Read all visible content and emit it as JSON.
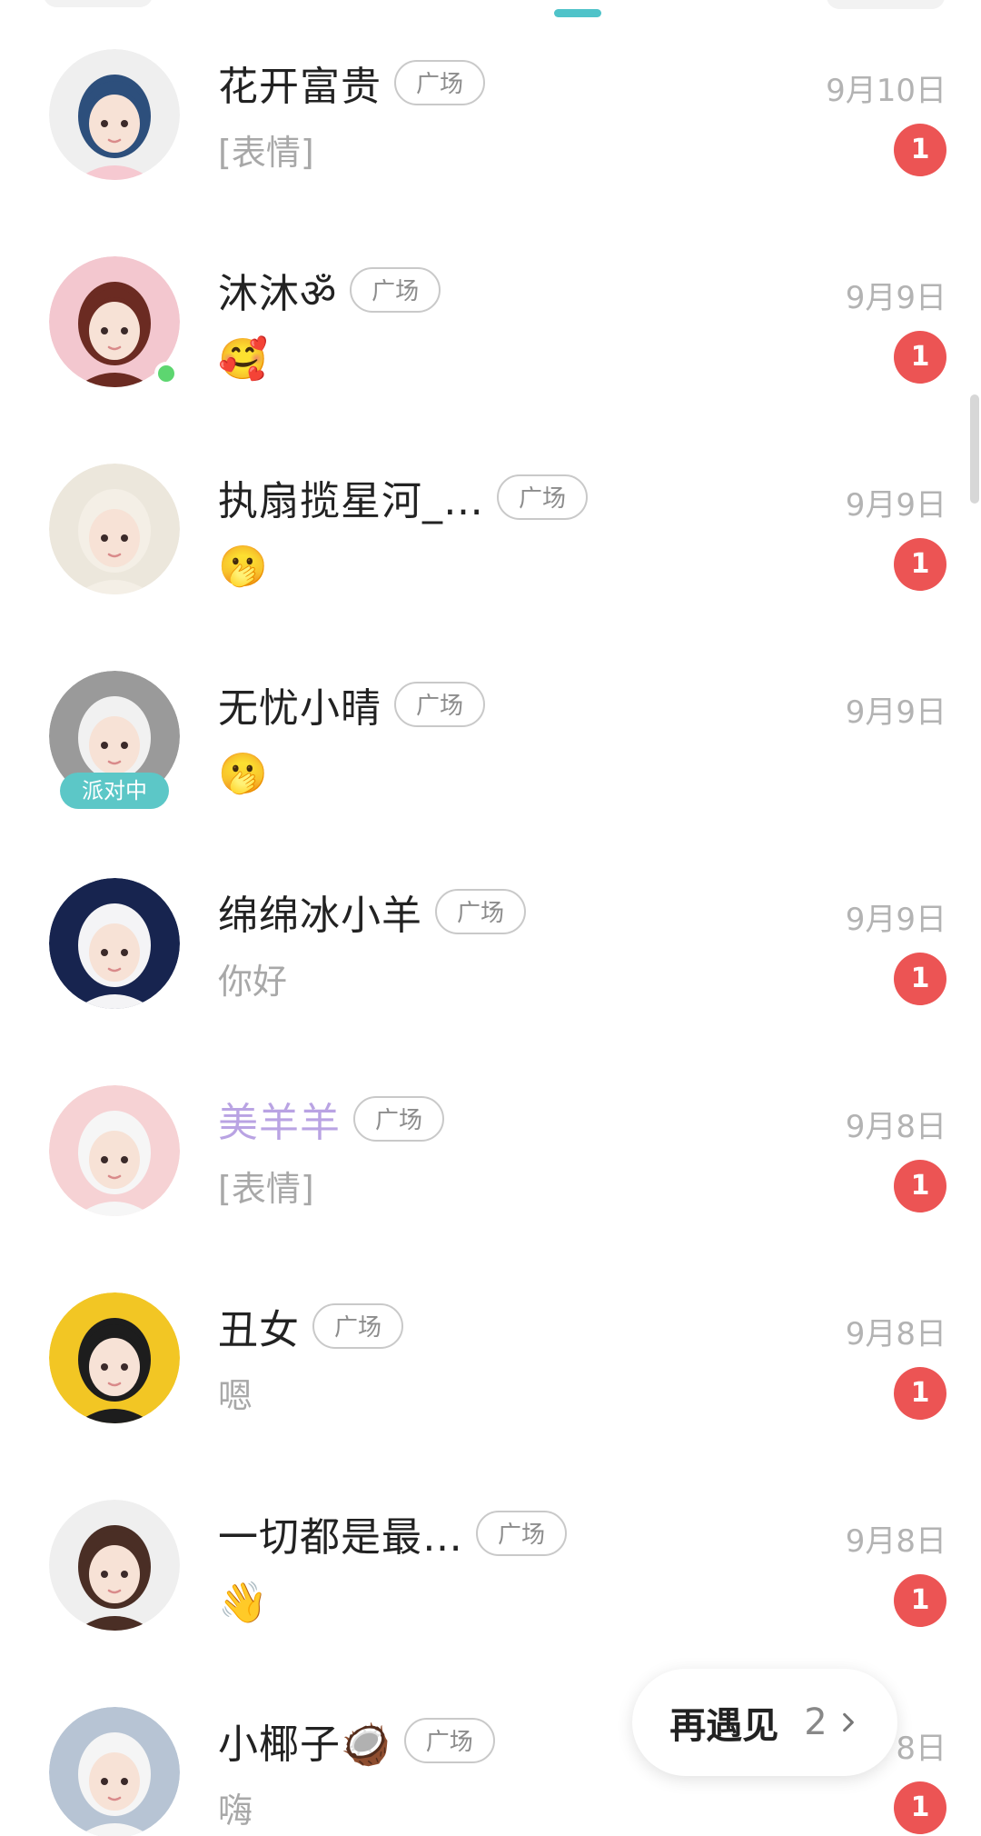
{
  "header": {
    "active_tab_color": "#4fc3c9"
  },
  "conversations": [
    {
      "name": "花开富贵",
      "tag": "广场",
      "time": "9月10日",
      "preview": "[表情]",
      "unread": "1",
      "avatar_bg": "#efefef",
      "avatar_icon": "girl-mask-avatar-icon"
    },
    {
      "name": "沐沐ॐ",
      "tag": "广场",
      "time": "9月9日",
      "preview": "🥰",
      "unread": "1",
      "avatar_bg": "#f3c7cf",
      "avatar_icon": "girl-cat-ears-avatar-icon",
      "online": true
    },
    {
      "name": "执扇揽星河_…",
      "tag": "广场",
      "time": "9月9日",
      "preview": "🫢",
      "unread": "1",
      "avatar_bg": "#ece7dc",
      "avatar_icon": "white-hair-girl-avatar-icon"
    },
    {
      "name": "无忧小晴",
      "tag": "广场",
      "time": "9月9日",
      "preview": "🫢",
      "unread": "",
      "avatar_bg": "#9a9a9a",
      "avatar_icon": "silver-hair-avatar-icon",
      "badge": "派对中"
    },
    {
      "name": "绵绵冰小羊",
      "tag": "广场",
      "time": "9月9日",
      "preview": "你好",
      "unread": "1",
      "avatar_bg": "#17244f",
      "avatar_icon": "sheep-girl-avatar-icon"
    },
    {
      "name": "美羊羊",
      "tag": "广场",
      "time": "9月8日",
      "preview": "[表情]",
      "unread": "1",
      "avatar_bg": "#f6d2d4",
      "avatar_icon": "pink-bow-girl-avatar-icon",
      "vip": true
    },
    {
      "name": "丑女",
      "tag": "广场",
      "time": "9月8日",
      "preview": "嗯",
      "unread": "1",
      "avatar_bg": "#f2c624",
      "avatar_icon": "black-hair-girl-avatar-icon"
    },
    {
      "name": "一切都是最…",
      "tag": "广场",
      "time": "9月8日",
      "preview": "👋",
      "unread": "1",
      "avatar_bg": "#efefef",
      "avatar_icon": "brown-hair-girl-avatar-icon"
    },
    {
      "name": "小椰子🥥",
      "tag": "广场",
      "time": "8日",
      "preview": "嗨",
      "unread": "1",
      "avatar_bg": "#b7c4d4",
      "avatar_icon": "white-hair-angry-avatar-icon"
    }
  ],
  "meet_again": {
    "label": "再遇见",
    "count": "2",
    "icon": "chevron-right-icon"
  }
}
